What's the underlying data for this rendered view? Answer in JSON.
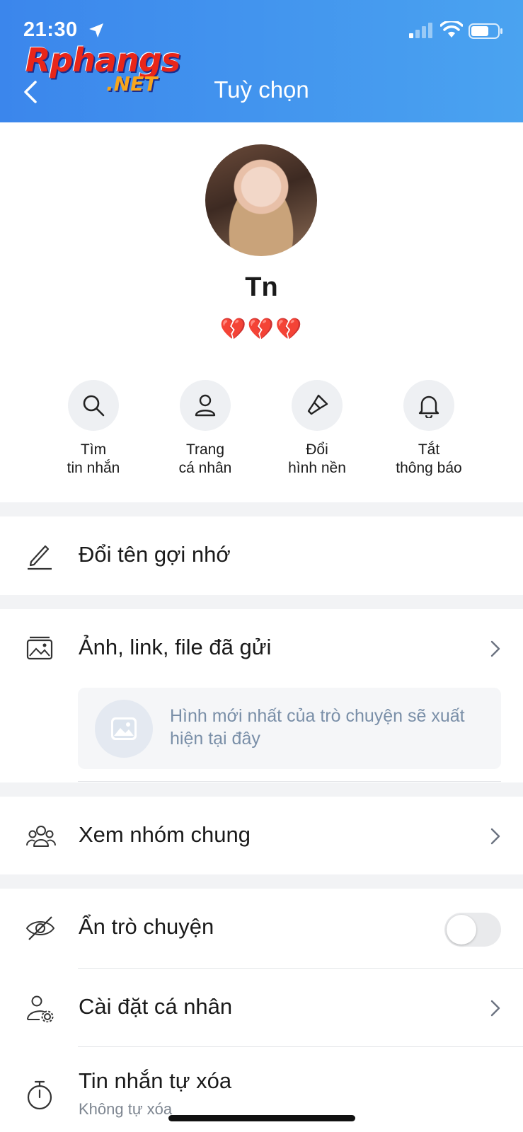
{
  "status_bar": {
    "time": "21:30"
  },
  "watermark": {
    "main": "Rphangs",
    "suffix": ".NET"
  },
  "header": {
    "title": "Tuỳ chọn"
  },
  "profile": {
    "name": "Tn",
    "status": "💔💔💔"
  },
  "quick_actions": [
    {
      "label": "Tìm\ntin nhắn",
      "icon": "search-icon"
    },
    {
      "label": "Trang\ncá nhân",
      "icon": "user-icon"
    },
    {
      "label": "Đổi\nhình nền",
      "icon": "paint-brush-icon"
    },
    {
      "label": "Tắt\nthông báo",
      "icon": "bell-icon"
    }
  ],
  "rows": {
    "rename": {
      "label": "Đổi tên gợi nhớ",
      "icon": "pencil-icon"
    },
    "media": {
      "label": "Ảnh, link, file đã gửi",
      "icon": "image-folder-icon",
      "placeholder": "Hình mới nhất của trò chuyện sẽ xuất hiện tại đây"
    },
    "groups": {
      "label": "Xem nhóm chung",
      "icon": "group-icon"
    },
    "hide": {
      "label": "Ẩn trò chuyện",
      "icon": "eye-off-icon",
      "toggle_on": false
    },
    "personal_settings": {
      "label": "Cài đặt cá nhân",
      "icon": "user-settings-icon"
    },
    "auto_delete": {
      "label": "Tin nhắn tự xóa",
      "sub": "Không tự xóa",
      "icon": "timer-icon"
    }
  },
  "colors": {
    "header_start": "#3b86ec",
    "header_end": "#4aa3f0",
    "accent": "#3b86ec"
  }
}
